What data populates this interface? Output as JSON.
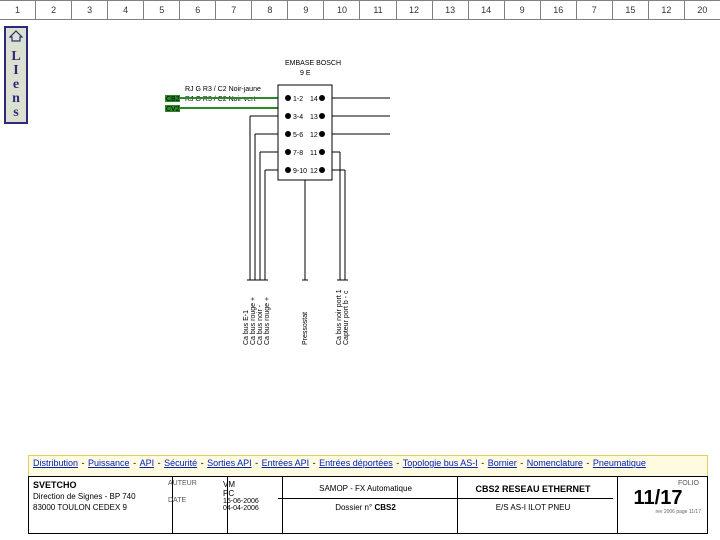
{
  "ruler": [
    "1",
    "2",
    "3",
    "4",
    "5",
    "6",
    "7",
    "8",
    "9",
    "10",
    "11",
    "12",
    "13",
    "14",
    "9",
    "16",
    "7",
    "15",
    "12",
    "20"
  ],
  "sidebar": {
    "letters": [
      "L",
      "I",
      "e",
      "n",
      "s"
    ]
  },
  "schematic": {
    "header_top": "EMBASE BOSCH",
    "header_sub": "9 E",
    "wire1": "RJ G R3 / C2 Noir-jaune",
    "wire2": "RJ G R3 / C2 Noir-vert",
    "tag1": "CB2",
    "tag2": "CV2",
    "row_labels": [
      "1-2",
      "14",
      "3-4",
      "13",
      "5-6",
      "12",
      "7-8",
      "11",
      "9-10",
      "12"
    ],
    "vnotes_left": [
      "Ca bus E-1",
      "Ca bus rouge +",
      "Ca bus noir -",
      "Ca bus rouge +"
    ],
    "vnotes_mid": [
      "Pressostat",
      "Ca bus noir port 1",
      "Capteur port b - c"
    ]
  },
  "nav": {
    "items": [
      "Distribution",
      "Puissance",
      "API",
      "Sécurité",
      "Sorties API",
      "Entrées API",
      "Entrées déportées",
      "Topologie bus AS-I",
      "Bornier",
      "Nomenclature",
      "Pneumatique"
    ]
  },
  "title": {
    "company": "SVETCHO",
    "addr1": "Direction de Signes - BP 740",
    "addr2": "83000 TOULON CEDEX 9",
    "col2_a": "AUTEUR",
    "col2_b": "VM",
    "col2_c": "PC",
    "date1": "16-06-2006",
    "date2": "04-04-2006",
    "main_line": "SAMOP - FX Automatique",
    "dossier_lbl": "Dossier n°",
    "dossier_val": "CBS2",
    "project": "CBS2 RESEAU ETHERNET",
    "sub": "E/S AS-I ILOT PNEU",
    "folio_lbl": "FOLIO",
    "page": "11/17",
    "fine": "rev 2006 page 11/17"
  }
}
